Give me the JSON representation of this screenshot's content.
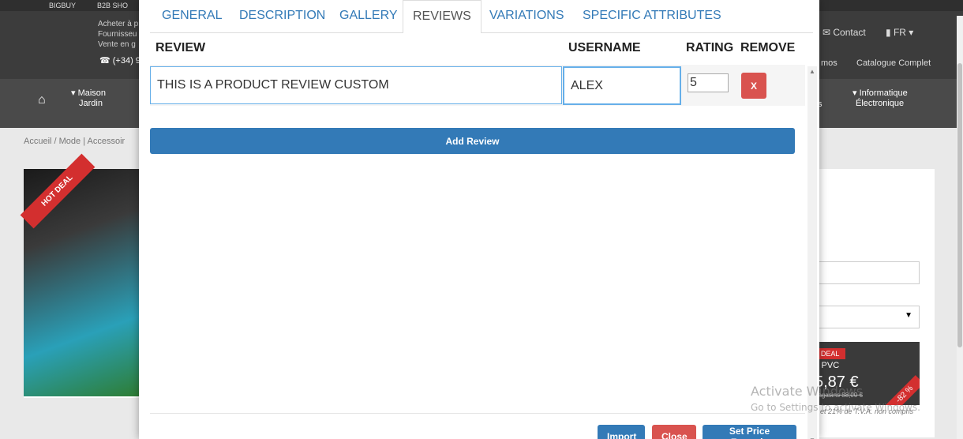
{
  "background": {
    "topbar": [
      "BIGBUY",
      "B2B SHO"
    ],
    "info_lines": [
      "Acheter à p",
      "Fournisseu",
      "Vente en g"
    ],
    "phone": "☎ (+34) 9",
    "contact": "✉ Contact",
    "lang": "FR",
    "promos": "mos",
    "catalog": "Catalogue Complet",
    "nav": {
      "home_icon": "home-icon",
      "maison": "Maison",
      "jardin": "Jardin",
      "s_item": "s",
      "informatique": "Informatique",
      "electronique": "Électronique"
    },
    "breadcrumb": "Accueil  /  Mode | Accessoir",
    "hot_deal": "HOT DEAL",
    "deal_tag": "T DEAL",
    "deal_desc": "v PVC",
    "deal_price": "5,87 €",
    "deal_old": "nagasins 88,00 €",
    "deal_pct": "-82 %",
    "vat_note": "t et 21% de T.V.A. non compris"
  },
  "modal": {
    "tabs": [
      {
        "label": "GENERAL",
        "active": false
      },
      {
        "label": "DESCRIPTION",
        "active": false
      },
      {
        "label": "GALLERY",
        "active": false
      },
      {
        "label": "REVIEWS",
        "active": true
      },
      {
        "label": "VARIATIONS",
        "active": false
      },
      {
        "label": "SPECIFIC ATTRIBUTES",
        "active": false
      }
    ],
    "headers": {
      "review": "REVIEW",
      "username": "USERNAME",
      "rating": "RATING",
      "remove": "REMOVE"
    },
    "row": {
      "review": "THIS IS A PRODUCT REVIEW CUSTOM",
      "username": "ALEX",
      "rating": "5",
      "remove_label": "X"
    },
    "add_review": "Add Review",
    "buttons": {
      "import": "Import",
      "close": "Close",
      "set_price": "Set Price Formula"
    }
  },
  "watermark": {
    "line1": "Activate Windows",
    "line2": "Go to Settings to activate Windows."
  },
  "colors": {
    "primary": "#337ab7",
    "danger": "#d9534f",
    "focus": "#66afe9"
  }
}
